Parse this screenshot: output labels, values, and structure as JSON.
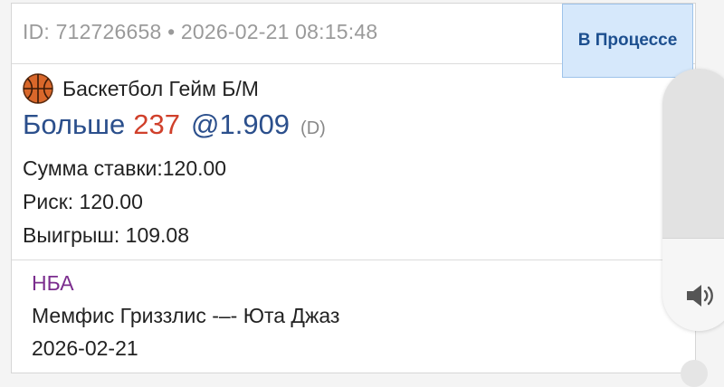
{
  "header": {
    "meta": "ID: 712726658 • 2026-02-21 08:15:48",
    "status": "В Процессе"
  },
  "bet": {
    "sport": "Баскетбол Гейм Б/М",
    "pick": "Больше",
    "line": "237",
    "odds": "@1.909",
    "format": "(D)",
    "stake": "Сумма ставки:120.00",
    "risk": "Риск: 120.00",
    "win": "Выигрыш: 109.08"
  },
  "event": {
    "league": "НБА",
    "teams": "Мемфис Гриззлис -–- Юта Джаз",
    "date": "2026-02-21"
  },
  "volume": {
    "level": 0.35,
    "icon": "volume-icon"
  },
  "colors": {
    "status_bg": "#d6e8fb",
    "status_text": "#1d4f8f",
    "pick": "#2b4f8c",
    "line": "#d0402b",
    "league": "#7b2d8e"
  }
}
